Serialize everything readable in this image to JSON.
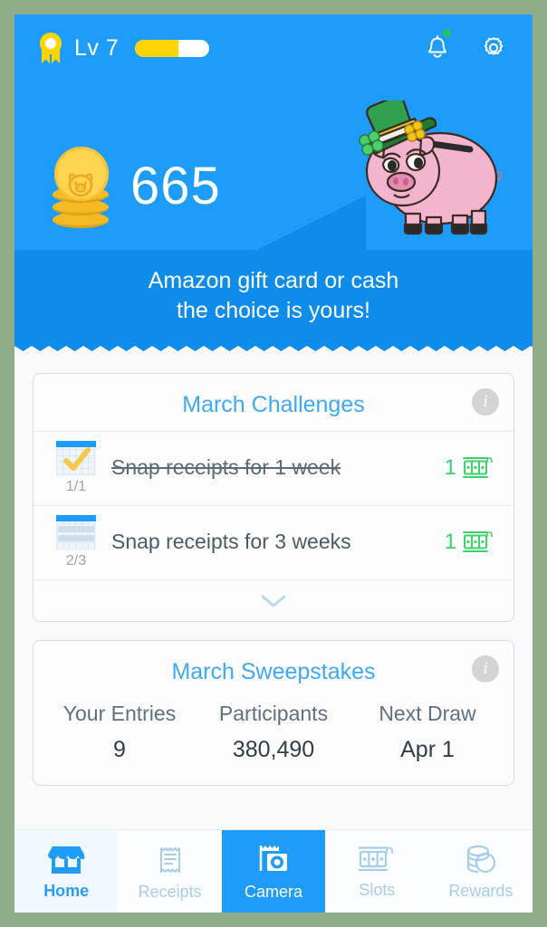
{
  "header": {
    "level_label": "Lv 7",
    "level_progress_pct": 58,
    "badge_icon": "rosette-badge-icon",
    "bell_icon": "bell-icon",
    "has_notification": true,
    "gear_icon": "gear-icon",
    "points": "665",
    "coin_icon": "coin-stack-icon",
    "mascot_icon": "piggy-bank-leprechaun-icon",
    "accent_blue": "#1e9cfa"
  },
  "banner": {
    "line1": "Amazon gift card or cash",
    "line2": "the choice is yours!",
    "background": "#0d8ceb"
  },
  "challenges": {
    "title": "March Challenges",
    "info_icon": "info-icon",
    "expand_icon": "chevron-down-icon",
    "rows": [
      {
        "icon": "calendar-check-icon",
        "progress": "1/1",
        "label": "Snap receipts for 1 week",
        "completed": true,
        "reward_count": "1",
        "reward_icon": "slot-machine-icon"
      },
      {
        "icon": "calendar-progress-icon",
        "progress": "2/3",
        "label": "Snap receipts for 3 weeks",
        "completed": false,
        "reward_count": "1",
        "reward_icon": "slot-machine-icon"
      }
    ]
  },
  "sweepstakes": {
    "title": "March Sweepstakes",
    "info_icon": "info-icon",
    "stats": [
      {
        "label": "Your Entries",
        "value": "9"
      },
      {
        "label": "Participants",
        "value": "380,490"
      },
      {
        "label": "Next Draw",
        "value": "Apr 1"
      }
    ]
  },
  "nav": {
    "items": [
      {
        "label": "Home",
        "icon": "storefront-icon",
        "state": "active-home"
      },
      {
        "label": "Receipts",
        "icon": "receipt-icon",
        "state": ""
      },
      {
        "label": "Camera",
        "icon": "camera-icon",
        "state": "active-cam"
      },
      {
        "label": "Slots",
        "icon": "slot-machine-icon",
        "state": ""
      },
      {
        "label": "Rewards",
        "icon": "coin-stack-icon",
        "state": ""
      }
    ]
  }
}
